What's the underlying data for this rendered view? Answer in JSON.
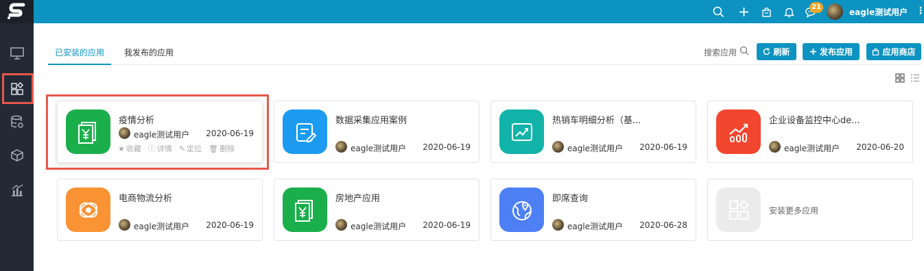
{
  "topbar": {
    "badge_count": "21",
    "username": "eagle测试用户",
    "kebab": "⋮"
  },
  "tabs": [
    {
      "label": "已安装的应用",
      "active": true
    },
    {
      "label": "我发布的应用",
      "active": false
    }
  ],
  "toolbar": {
    "search_label": "搜索应用",
    "refresh_label": "刷新",
    "publish_label": "发布应用",
    "store_label": "应用商店"
  },
  "cards": [
    {
      "title": "疫情分析",
      "user": "eagle测试用户",
      "date": "2020-06-19",
      "icon": "yuan-doc-icon",
      "color": "#1aaf4b"
    },
    {
      "title": "数据采集应用案例",
      "user": "eagle测试用户",
      "date": "2020-06-19",
      "icon": "form-edit-icon",
      "color": "#1c9bf0"
    },
    {
      "title": "热销车明细分析（基...",
      "user": "eagle测试用户",
      "date": "2020-06-19",
      "icon": "trend-chart-icon",
      "color": "#12b3a8"
    },
    {
      "title": "企业设备监控中心de...",
      "user": "eagle测试用户",
      "date": "2020-06-20",
      "icon": "growth-chart-icon",
      "color": "#f2462e"
    },
    {
      "title": "电商物流分析",
      "user": "eagle测试用户",
      "date": "2020-06-19",
      "icon": "logistics-icon",
      "color": "#f99334"
    },
    {
      "title": "房地产应用",
      "user": "eagle测试用户",
      "date": "2020-06-19",
      "icon": "yuan-doc-icon",
      "color": "#1aaf4b"
    },
    {
      "title": "即席查询",
      "user": "eagle测试用户",
      "date": "2020-06-28",
      "icon": "globe-pin-icon",
      "color": "#4d7ff5"
    }
  ],
  "card_actions": {
    "favorite": "收藏",
    "details": "详情",
    "locate": "定位",
    "delete": "删除"
  },
  "more_apps_label": "安装更多应用"
}
